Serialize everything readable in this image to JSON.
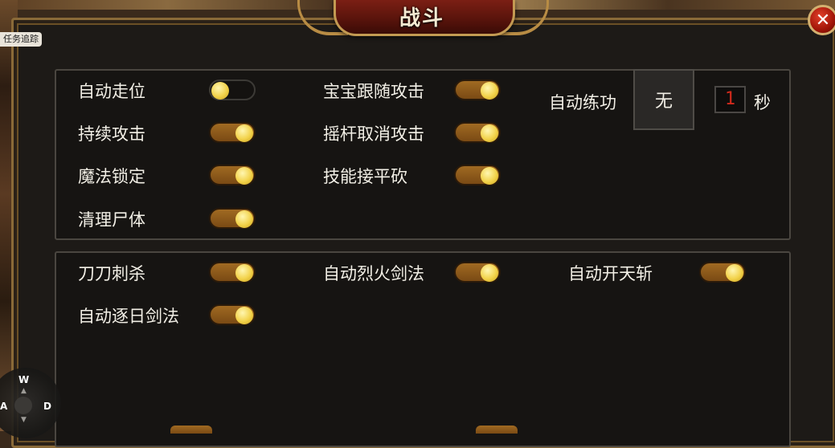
{
  "window": {
    "title": "战斗",
    "close_label": "✕",
    "task_tab_label": "任务追踪"
  },
  "panel1": {
    "items": [
      {
        "label": "自动走位",
        "on": false
      },
      {
        "label": "持续攻击",
        "on": true
      },
      {
        "label": "魔法锁定",
        "on": true
      },
      {
        "label": "清理尸体",
        "on": true
      },
      {
        "label": "宝宝跟随攻击",
        "on": true
      },
      {
        "label": "摇杆取消攻击",
        "on": true
      },
      {
        "label": "技能接平砍",
        "on": true
      }
    ],
    "auto_practice": {
      "label": "自动练功",
      "mode_value": "无",
      "seconds_value": "1",
      "seconds_unit": "秒"
    }
  },
  "panel2": {
    "items": [
      {
        "label": "刀刀刺杀",
        "on": true
      },
      {
        "label": "自动逐日剑法",
        "on": true
      },
      {
        "label": "自动烈火剑法",
        "on": true
      },
      {
        "label": "自动开天斩",
        "on": true
      }
    ]
  },
  "compass": {
    "north_label": "W",
    "east_label": "D",
    "west_label": "A"
  },
  "colors": {
    "toggle_on": "#a06a22",
    "knob": "#f2d24a",
    "frame_gold": "#c39a52",
    "title_red": "#7b1f14",
    "seconds_text": "#d22a1c"
  }
}
